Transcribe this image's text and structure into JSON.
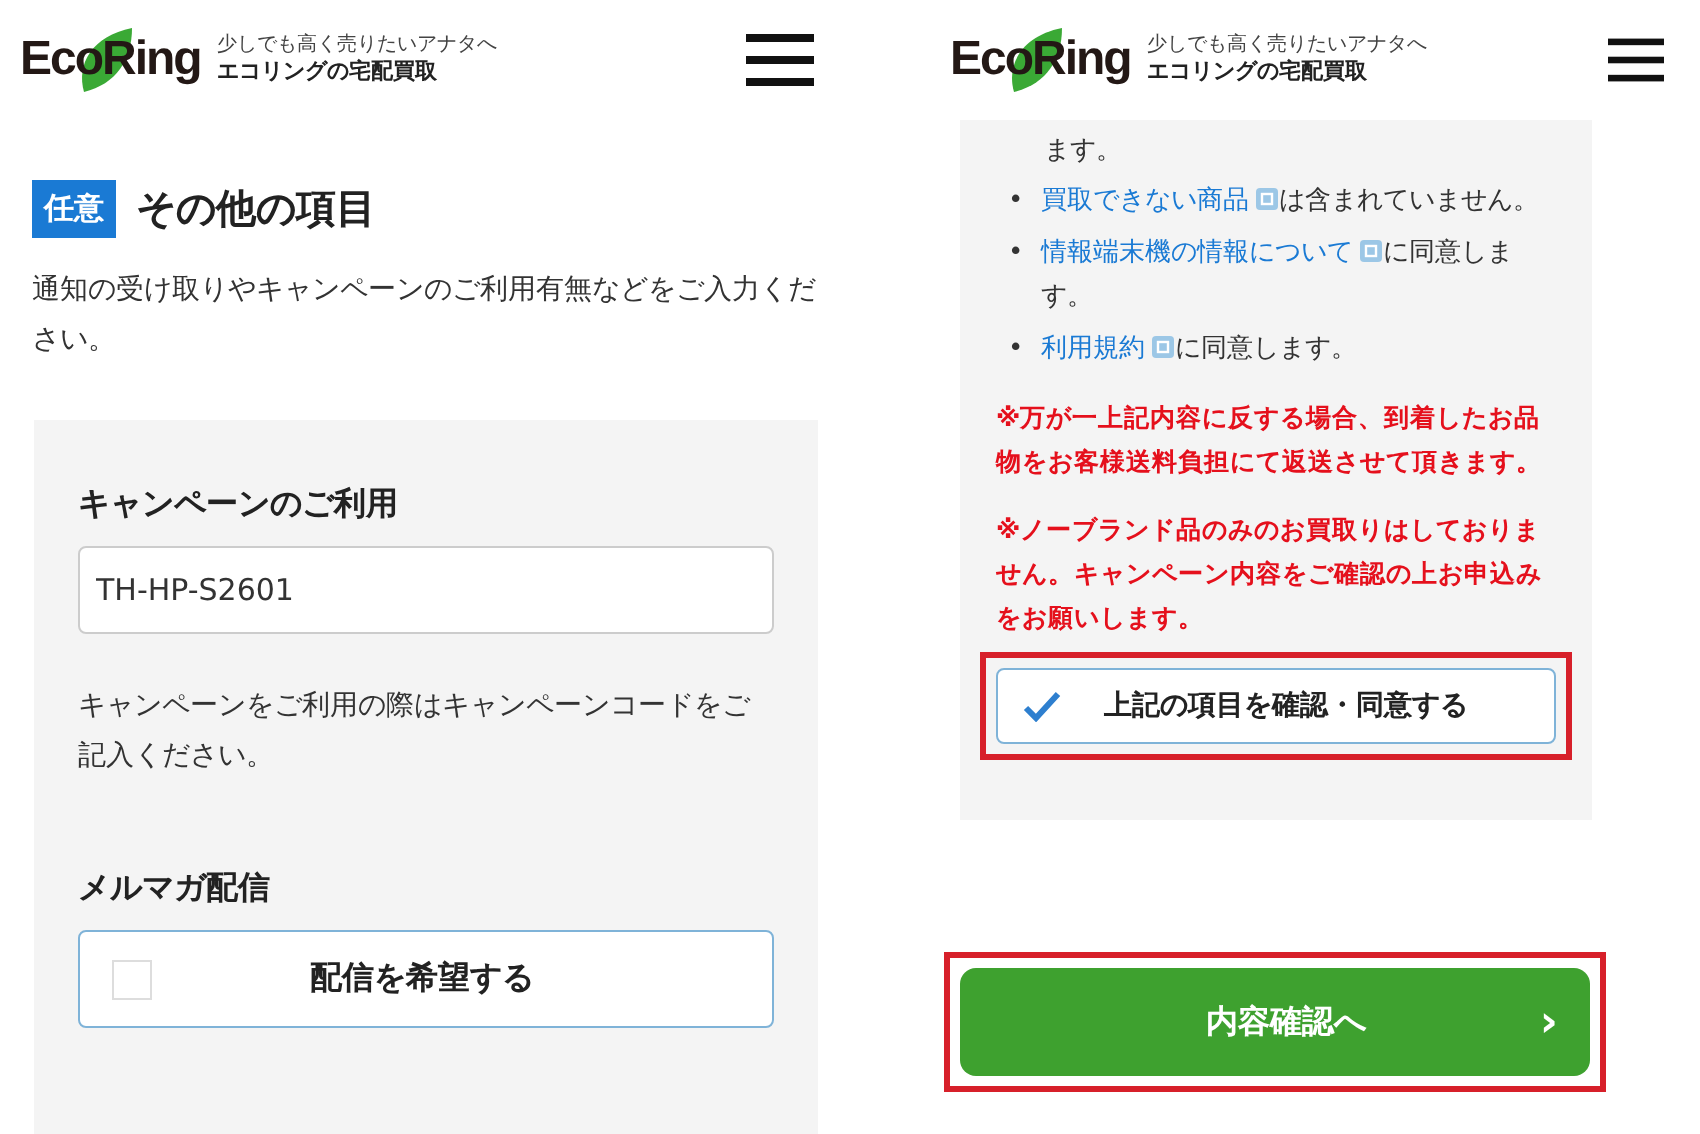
{
  "screens": [
    {
      "header": {
        "logo": "EcoRing",
        "tagline": "少しでも高く売りたいアナタへ",
        "service": "エコリングの宅配買取"
      },
      "section": {
        "badge": "任意",
        "title": "その他の項目",
        "description": "通知の受け取りやキャンペーンのご利用有無などをご入力ください。"
      },
      "card": {
        "blocks": [
          {
            "kind": "field",
            "label": "キャンペーンのご利用",
            "value": "TH-HP-S2601",
            "help": "キャンペーンをご利用の際はキャンペーンコードをご記入ください。"
          },
          {
            "kind": "checkbox",
            "label": "メルマガ配信",
            "option": "配信を希望する",
            "checked": false
          }
        ]
      }
    },
    {
      "header": {
        "logo": "EcoRing",
        "tagline": "少しでも高く売りたいアナタへ",
        "service": "エコリングの宅配買取"
      },
      "card": {
        "continuation": "ます。",
        "bullets": [
          {
            "marker": "•",
            "link": "買取できない商品",
            "rest": "は含まれていません。"
          },
          {
            "marker": "•",
            "link": "情報端末機の情報について",
            "rest": "に同意します。"
          },
          {
            "marker": "•",
            "link": "利用規約",
            "rest": "に同意します。"
          }
        ],
        "notes": [
          "※万が一上記内容に反する場合、到着したお品物をお客様送料負担にて返送させて頂きます。",
          "※ノーブランド品のみのお買取りはしておりません。キャンペーン内容をご確認の上お申込みをお願いします。"
        ],
        "agree": {
          "label": "上記の項目を確認・同意する",
          "checked": true,
          "highlighted": true
        }
      },
      "next_button": {
        "label": "内容確認へ",
        "arrow": "›",
        "highlighted": true
      }
    }
  ]
}
